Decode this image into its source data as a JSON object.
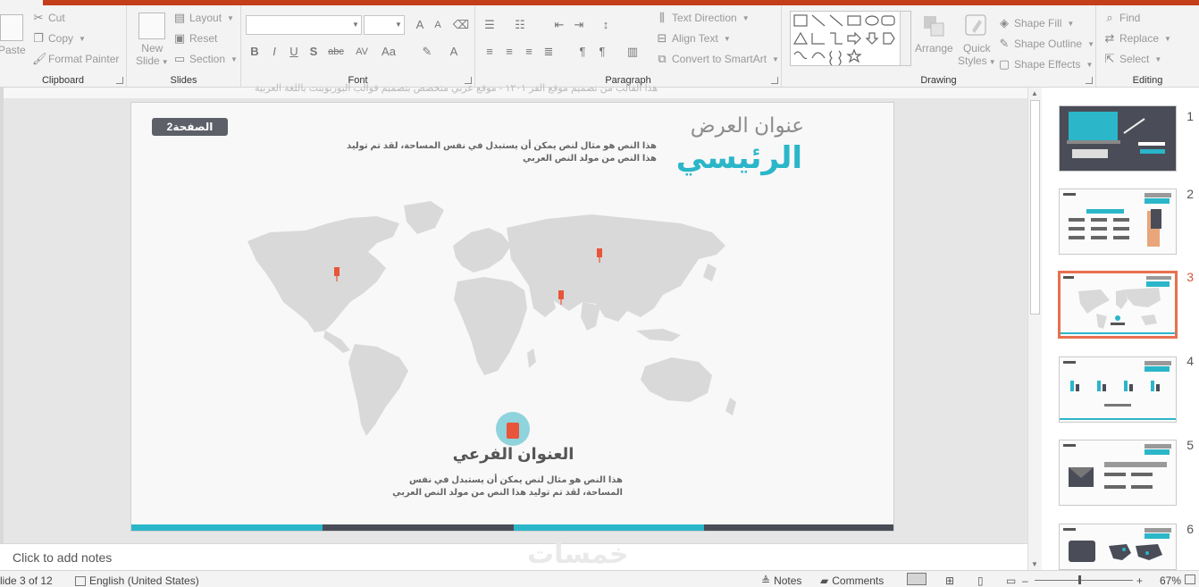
{
  "ribbon": {
    "clipboard": {
      "label": "Clipboard",
      "paste": "Paste",
      "cut": "Cut",
      "copy": "Copy",
      "format_painter": "Format Painter"
    },
    "slides": {
      "label": "Slides",
      "new_slide_line1": "New",
      "new_slide_line2": "Slide",
      "layout": "Layout",
      "reset": "Reset",
      "section": "Section"
    },
    "font": {
      "label": "Font",
      "font_name": "",
      "font_size": "",
      "bold": "B",
      "italic": "I",
      "underline": "U",
      "shadow": "S",
      "strike": "abc",
      "spacing": "AV",
      "case": "Aa",
      "color": "A"
    },
    "paragraph": {
      "label": "Paragraph",
      "text_direction": "Text Direction",
      "align_text": "Align Text",
      "convert_smartart": "Convert to SmartArt"
    },
    "drawing": {
      "label": "Drawing",
      "arrange": "Arrange",
      "quick_styles_line1": "Quick",
      "quick_styles_line2": "Styles",
      "shape_fill": "Shape Fill",
      "shape_outline": "Shape Outline",
      "shape_effects": "Shape Effects"
    },
    "editing": {
      "label": "Editing",
      "find": "Find",
      "replace": "Replace",
      "select": "Select"
    }
  },
  "ghost_text": "هذا الفالب من تصميم موقع الفر ١٢٠١ - موقع عربي متخصص بتصميم قوالب البوربوينت باللغة العربية",
  "slide": {
    "page_label": "الصفحة2",
    "title_line1": "عنوان العرض",
    "title_line2": "الرئيسي",
    "body_text_1": "هذا النص هو مثال لنص يمكن أن يستبدل في نفس المساحة، لقد تم توليد هذا النص من مولد النص العربي",
    "subtitle": "العنوان الفرعي",
    "body_text_2": "هذا النص هو مثال لنص يمكن أن يستبدل في نفس المساحة، لقد تم توليد هذا النص من مولد النص العربي",
    "map_color": "#d9d9d9",
    "pin_color": "#e8553a",
    "stripe_colors": [
      "#2bb6c9",
      "#4a4d57",
      "#2bb6c9",
      "#4a4d57"
    ]
  },
  "thumbnails": [
    {
      "num": "1"
    },
    {
      "num": "2"
    },
    {
      "num": "3"
    },
    {
      "num": "4"
    },
    {
      "num": "5"
    },
    {
      "num": "6"
    }
  ],
  "notes": {
    "placeholder": "Click to add notes",
    "watermark": "خمسات"
  },
  "status": {
    "slide_info": "lide 3 of 12",
    "language": "English (United States)",
    "notes": "Notes",
    "comments": "Comments",
    "zoom": "67%"
  },
  "colors": {
    "accent": "#c43e1c",
    "teal": "#2bb6c9",
    "dark": "#4a4d57",
    "active_thumb": "#e8704e"
  }
}
